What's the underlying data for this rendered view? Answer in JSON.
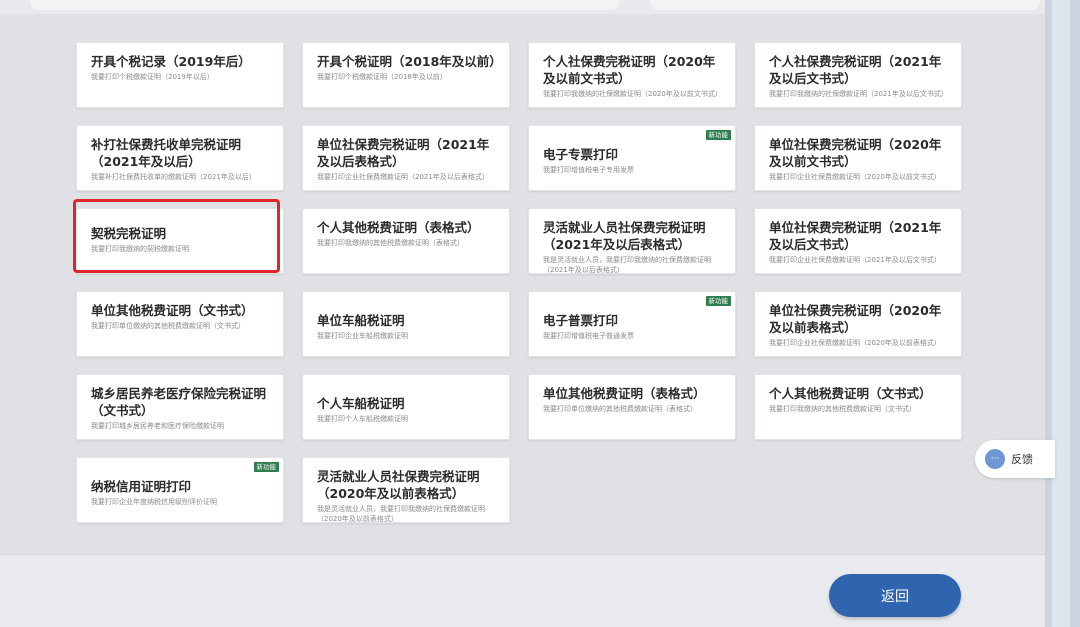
{
  "cards": [
    {
      "title": "开具个税记录（2019年后）",
      "desc": "我要打印个税缴款证明（2019年以后）"
    },
    {
      "title": "开具个税证明（2018年及以前）",
      "desc": "我要打印个税缴款证明（2018年及以前）"
    },
    {
      "title": "个人社保费完税证明（2020年及以前文书式）",
      "desc": "我要打印我缴纳的社保缴款证明（2020年及以前文书式）"
    },
    {
      "title": "个人社保费完税证明（2021年及以后文书式）",
      "desc": "我要打印我缴纳的社保缴款证明（2021年及以后文书式）"
    },
    {
      "title": "补打社保费托收单完税证明（2021年及以后）",
      "desc": "我要补打社保费托收单的缴款证明（2021年及以后）"
    },
    {
      "title": "单位社保费完税证明（2021年及以后表格式）",
      "desc": "我要打印企业社保费缴款证明（2021年及以后表格式）"
    },
    {
      "title": "电子专票打印",
      "desc": "我要打印增值税电子专用发票",
      "badge": "新功能"
    },
    {
      "title": "单位社保费完税证明（2020年及以前文书式）",
      "desc": "我要打印企业社保费缴款证明（2020年及以前文书式）"
    },
    {
      "title": "契税完税证明",
      "desc": "我要打印我缴纳的契税缴款证明"
    },
    {
      "title": "个人其他税费证明（表格式）",
      "desc": "我要打印我缴纳的其他税费缴款证明（表格式）"
    },
    {
      "title": "灵活就业人员社保费完税证明（2021年及以后表格式）",
      "desc": "我是灵活就业人员，我要打印我缴纳的社保费缴款证明（2021年及以后表格式）"
    },
    {
      "title": "单位社保费完税证明（2021年及以后文书式）",
      "desc": "我要打印企业社保费缴款证明（2021年及以后文书式）"
    },
    {
      "title": "单位其他税费证明（文书式）",
      "desc": "我要打印单位缴纳的其他税费缴款证明（文书式）"
    },
    {
      "title": "单位车船税证明",
      "desc": "我要打印企业车船税缴款证明"
    },
    {
      "title": "电子普票打印",
      "desc": "我要打印增值税电子普通发票",
      "badge": "新功能"
    },
    {
      "title": "单位社保费完税证明（2020年及以前表格式）",
      "desc": "我要打印企业社保费缴款证明（2020年及以前表格式）"
    },
    {
      "title": "城乡居民养老医疗保险完税证明（文书式）",
      "desc": "我要打印城乡居民养老和医疗保险缴款证明"
    },
    {
      "title": "个人车船税证明",
      "desc": "我要打印个人车船税缴款证明"
    },
    {
      "title": "单位其他税费证明（表格式）",
      "desc": "我要打印单位缴纳的其他税费缴款证明（表格式）"
    },
    {
      "title": "个人其他税费证明（文书式）",
      "desc": "我要打印我缴纳的其他税费缴款证明（文书式）"
    },
    {
      "title": "纳税信用证明打印",
      "desc": "我要打印企业年度纳税信用级别评价证明",
      "badge": "新功能"
    },
    {
      "title": "灵活就业人员社保费完税证明（2020年及以前表格式）",
      "desc": "我是灵活就业人员，我要打印我缴纳的社保费缴款证明（2020年及以前表格式）"
    }
  ],
  "feedback": {
    "icon": "chat-icon",
    "icon_glyph": "···",
    "label": "反馈"
  },
  "back_button": {
    "label": "返回"
  },
  "colors": {
    "accent": "#2f64ae",
    "highlight": "#e0242c",
    "badge": "#2e7d4f"
  }
}
